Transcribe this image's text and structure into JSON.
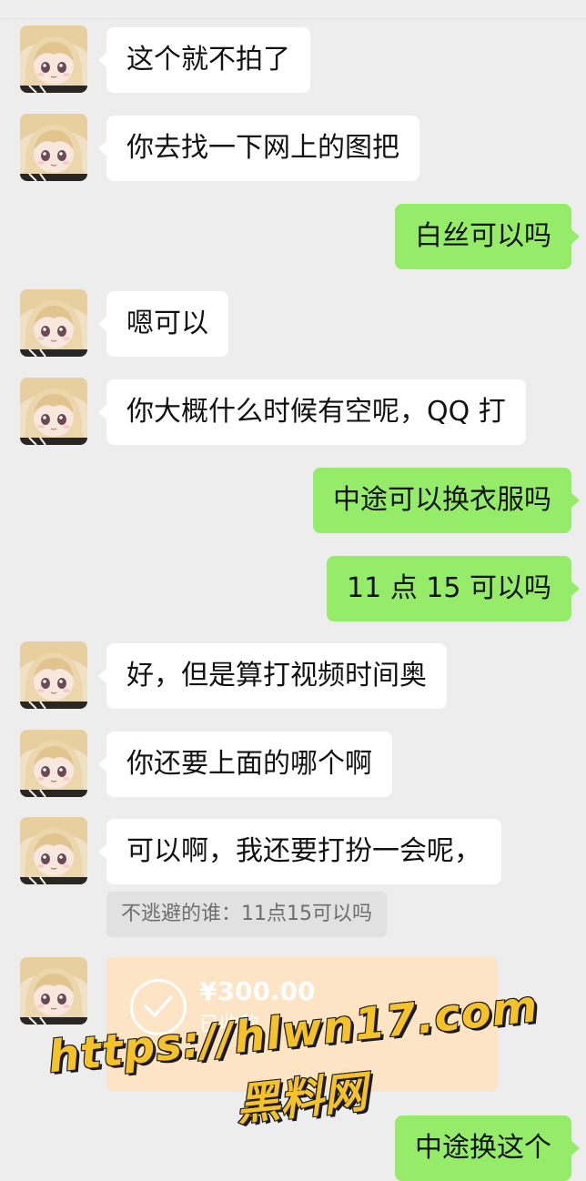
{
  "messages": [
    {
      "side": "in",
      "text": "这个就不拍了"
    },
    {
      "side": "in",
      "text": "你去找一下网上的图把"
    },
    {
      "side": "out",
      "text": "白丝可以吗"
    },
    {
      "side": "in",
      "text": "嗯可以"
    },
    {
      "side": "in",
      "text": "你大概什么时候有空呢，QQ 打"
    },
    {
      "side": "out",
      "text": "中途可以换衣服吗"
    },
    {
      "side": "out",
      "text": "11 点 15 可以吗"
    },
    {
      "side": "in",
      "text": "好，但是算打视频时间奥"
    },
    {
      "side": "in",
      "text": "你还要上面的哪个啊"
    },
    {
      "side": "in",
      "text": "可以啊，我还要打扮一会呢，"
    },
    {
      "side": "out",
      "text": "中途换这个"
    }
  ],
  "quote": {
    "text": "不逃避的谁：11点15可以吗"
  },
  "transfer": {
    "amount": "¥300.00",
    "status": "已收款"
  },
  "watermark": {
    "url": "https://hlwn17.com",
    "site": "黑料网"
  },
  "colors": {
    "background": "#ededed",
    "incoming_bubble": "#ffffff",
    "outgoing_bubble": "#95ec69",
    "transfer_card": "#fde4c4",
    "watermark_fill": "#f6c22a"
  },
  "icons": {
    "avatar": "anime-doll-avatar",
    "transfer": "check-circle-icon"
  }
}
